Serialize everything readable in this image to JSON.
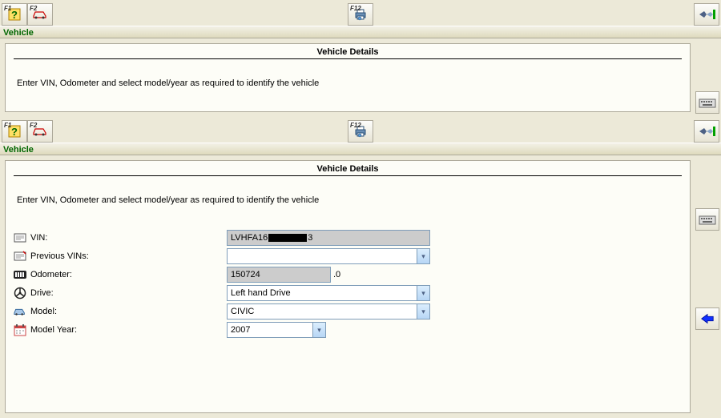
{
  "toolbar": {
    "f1": "F1",
    "f2": "F2",
    "f12": "F12"
  },
  "section_label": "Vehicle",
  "panel": {
    "title": "Vehicle Details",
    "instruction": "Enter VIN, Odometer and select model/year as required to identify the vehicle"
  },
  "form": {
    "vin": {
      "label": "VIN:",
      "value_prefix": "LVHFA16",
      "value_suffix": "3"
    },
    "prev_vins": {
      "label": "Previous VINs:",
      "value": ""
    },
    "odometer": {
      "label": "Odometer:",
      "value": "150724",
      "suffix": ".0"
    },
    "drive": {
      "label": "Drive:",
      "value": "Left hand Drive"
    },
    "model": {
      "label": "Model:",
      "value": "CIVIC"
    },
    "model_year": {
      "label": "Model Year:",
      "value": "2007"
    }
  }
}
